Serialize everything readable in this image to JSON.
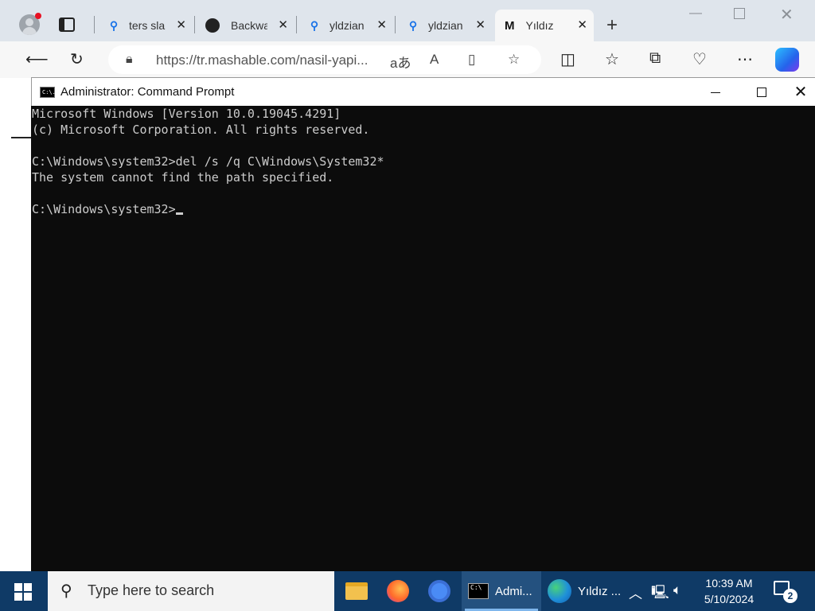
{
  "browser": {
    "tabs": [
      {
        "title": "ters sla",
        "icon": "search-icon"
      },
      {
        "title": "Backwa",
        "icon": "github-icon"
      },
      {
        "title": "yldzian",
        "icon": "search-icon"
      },
      {
        "title": "yldzian",
        "icon": "search-icon"
      },
      {
        "title": "Yıldız",
        "icon": "mashable-icon"
      }
    ],
    "url": "https://tr.mashable.com/nasil-yapi..."
  },
  "cmd": {
    "title": "Administrator: Command Prompt",
    "icon_label": "C:\\.",
    "lines": [
      "Microsoft Windows [Version 10.0.19045.4291]",
      "(c) Microsoft Corporation. All rights reserved.",
      "",
      "C:\\Windows\\system32>del /s /q C\\Windows\\System32*",
      "The system cannot find the path specified.",
      "",
      "C:\\Windows\\system32>"
    ]
  },
  "taskbar": {
    "search_placeholder": "Type here to search",
    "apps": [
      {
        "label": "Admi...",
        "icon": "cmd-icon"
      },
      {
        "label": "Yıldız ...",
        "icon": "edge-icon"
      }
    ],
    "time": "10:39 AM",
    "date": "5/10/2024",
    "notification_count": "2"
  }
}
